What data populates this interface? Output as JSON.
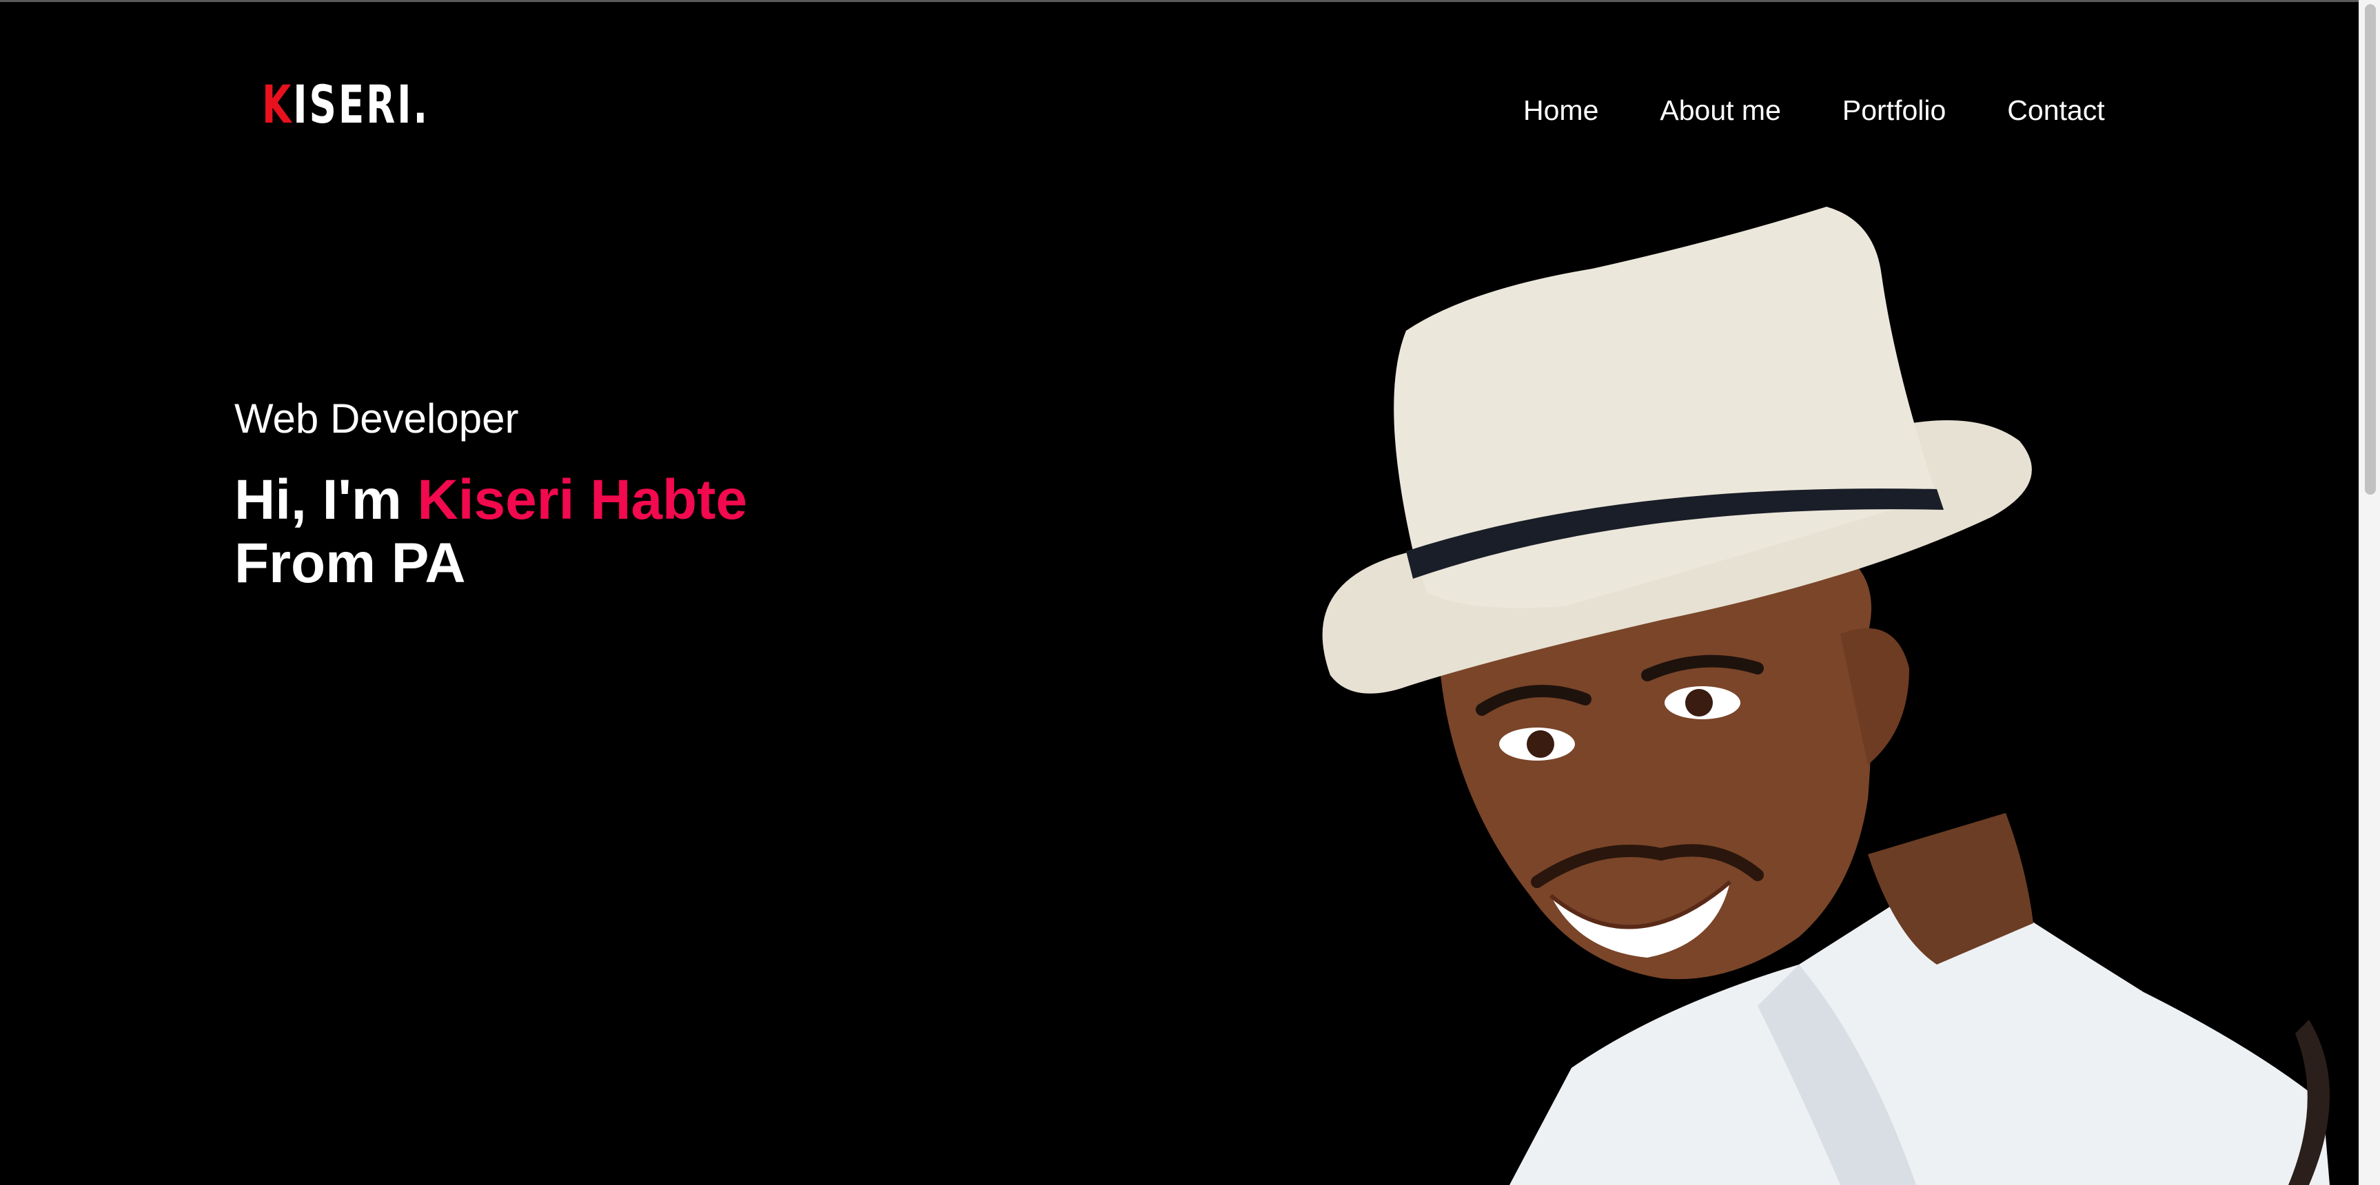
{
  "logo": {
    "accent_letter": "K",
    "rest": "ISERI",
    "dot": "."
  },
  "nav": {
    "items": [
      "Home",
      "About me",
      "Portfolio",
      "Contact"
    ]
  },
  "hero": {
    "role": "Web Developer",
    "greeting": "Hi, I'm ",
    "name": "Kiseri Habte",
    "location": "From PA"
  },
  "portrait": {
    "icon": "person-photo"
  },
  "colors": {
    "background": "#000000",
    "accent_name": "#f2094e",
    "accent_logo": "#e8111e",
    "text": "#ffffff"
  }
}
